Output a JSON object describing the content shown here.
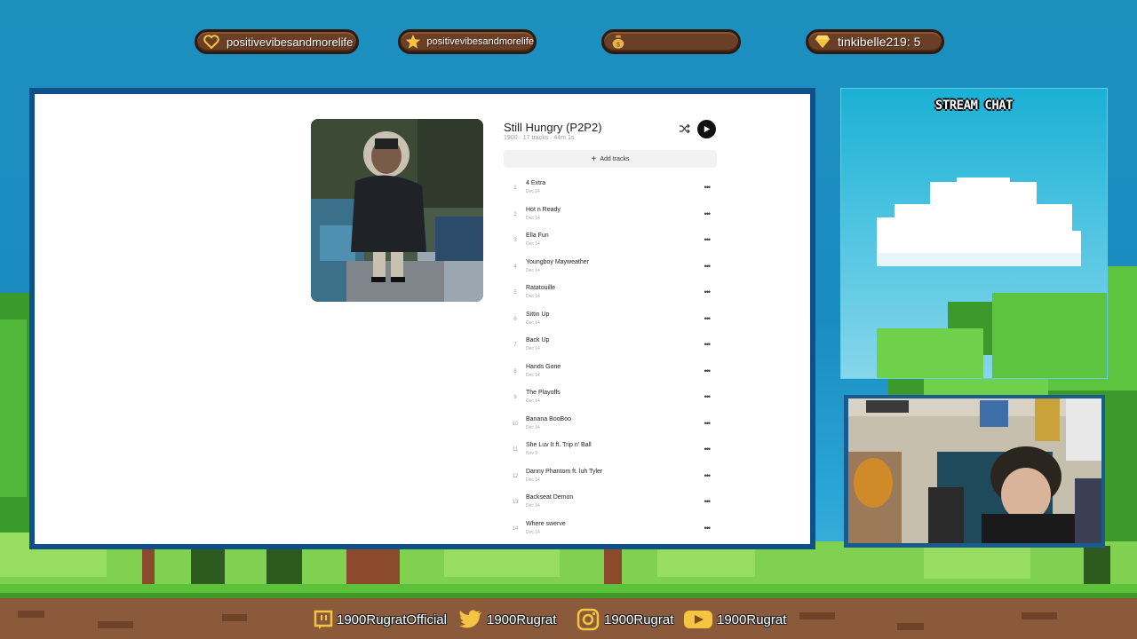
{
  "badges": [
    {
      "label": "positivevibesandmorelife",
      "icon": "heart-icon",
      "color": "#f5c542"
    },
    {
      "label": "positivevibesandmorelife",
      "icon": "star-icon",
      "color": "#f5c542"
    },
    {
      "label": "",
      "icon": "money-bag-icon",
      "color": "#f5c542"
    },
    {
      "label": "tinkibelle219: 5",
      "icon": "gem-icon",
      "color": "#f5c542"
    }
  ],
  "album": {
    "title": "Still Hungry (P2P2)",
    "meta": "1900 · 17 tracks · 44m 1s",
    "add_tracks_label": "Add tracks"
  },
  "tracks": [
    {
      "num": "1",
      "name": "4 Extra",
      "date": "Dec 24"
    },
    {
      "num": "2",
      "name": "Hot n Ready",
      "date": "Dec 14"
    },
    {
      "num": "3",
      "name": "Ella Fun",
      "date": "Dec 14"
    },
    {
      "num": "4",
      "name": "Youngboy Mayweather",
      "date": "Dec 14"
    },
    {
      "num": "5",
      "name": "Ratatouille",
      "date": "Dec 14"
    },
    {
      "num": "6",
      "name": "Sittin Up",
      "date": "Dec 14"
    },
    {
      "num": "7",
      "name": "Back Up",
      "date": "Dec 14"
    },
    {
      "num": "8",
      "name": "Hands Gone",
      "date": "Dec 14"
    },
    {
      "num": "9",
      "name": "The Playoffs",
      "date": "Dec 14"
    },
    {
      "num": "10",
      "name": "Banana BooBoo",
      "date": "Dec 14"
    },
    {
      "num": "11",
      "name": "She Luv It ft. Trip n' Ball",
      "date": "Nov 9"
    },
    {
      "num": "12",
      "name": "Danny Phantom ft. luh Tyler",
      "date": "Dec 14"
    },
    {
      "num": "13",
      "name": "Backseat Demon",
      "date": "Dec 14"
    },
    {
      "num": "14",
      "name": "Where swerve",
      "date": "Dec 14"
    }
  ],
  "chat": {
    "title": "STREAM CHAT"
  },
  "socials": [
    {
      "icon": "twitch-icon",
      "label": "1900RugratOfficial"
    },
    {
      "icon": "twitter-icon",
      "label": "1900Rugrat"
    },
    {
      "icon": "instagram-icon",
      "label": "1900Rugrat"
    },
    {
      "icon": "youtube-icon",
      "label": "1900Rugrat"
    }
  ]
}
